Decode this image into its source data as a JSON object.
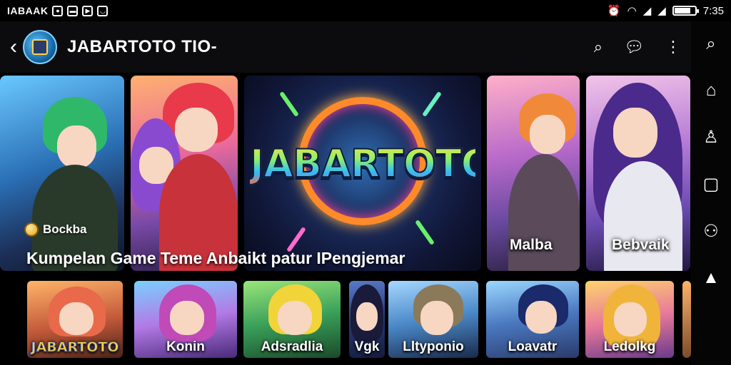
{
  "status_bar": {
    "carrier": "IABAAK",
    "time": "7:35",
    "battery_level_percent": 80
  },
  "app_bar": {
    "title": "JABARTOTO TIO-",
    "back_icon": "chevron-left-icon",
    "actions": [
      "search-icon",
      "chat-bubble-icon",
      "more-vert-icon"
    ]
  },
  "side_rail": {
    "items": [
      "search-icon",
      "home-icon",
      "profile-icon",
      "square-icon",
      "account-switch-icon",
      "bell-icon"
    ]
  },
  "feature_cards": [
    {
      "caption": ""
    },
    {
      "caption": ""
    },
    {
      "brand": "JABARTOTO"
    },
    {
      "caption": "Malba"
    },
    {
      "caption": "Bebvaik"
    }
  ],
  "badge": {
    "label": "Bockba"
  },
  "collection_title": "Kumpelan Game Teme Anbaikt patur IPengjemar",
  "thumbnails": [
    {
      "label": "JABARTOTO"
    },
    {
      "label": "Konin"
    },
    {
      "label": "Adsradlia"
    },
    {
      "label": "Vgk"
    },
    {
      "label": "Lltyponio"
    },
    {
      "label": "Loavatr"
    },
    {
      "label": "Ledolkg"
    },
    {
      "label": ""
    }
  ],
  "colors": {
    "background": "#000000",
    "app_bar": "#0c0c0e",
    "brand_yellow": "#ffd43a",
    "brand_ring": "#ff8a2a"
  }
}
